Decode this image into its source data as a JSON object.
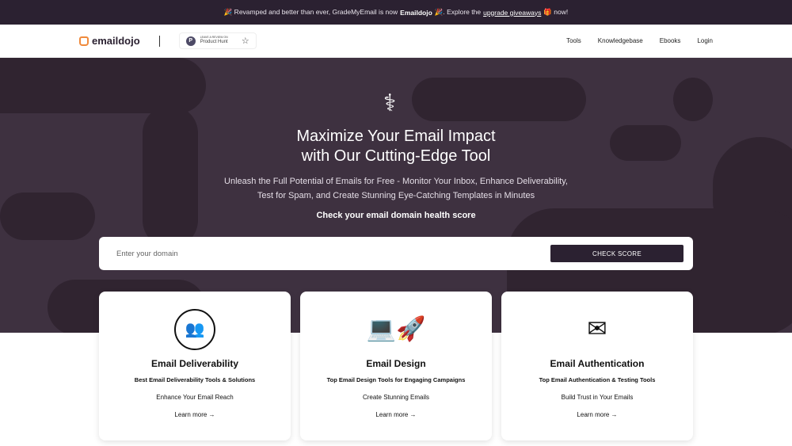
{
  "announcement": {
    "pre": "🎉 Revamped and better than ever, GradeMyEmail is now",
    "brand": "Emaildojo",
    "mid": "🎉. Explore the",
    "link": "upgrade giveaways",
    "post": "🎁 now!"
  },
  "nav": {
    "logo": "emaildojo",
    "ph_small": "LEAVE A REVIEW ON",
    "ph_label": "Product Hunt",
    "links": [
      "Tools",
      "Knowledgebase",
      "Ebooks",
      "Login"
    ]
  },
  "hero": {
    "title_line1": "Maximize Your Email Impact",
    "title_line2": "with Our Cutting-Edge Tool",
    "sub_line1": "Unleash the Full Potential of Emails for Free - Monitor Your Inbox, Enhance Deliverability,",
    "sub_line2": "Test for Spam, and Create Stunning Eye-Catching Templates in Minutes",
    "cta": "Check your email domain health score",
    "placeholder": "Enter your domain",
    "button": "CHECK SCORE"
  },
  "cards": [
    {
      "title": "Email Deliverability",
      "subtitle": "Best Email Deliverability Tools & Solutions",
      "desc": "Enhance Your Email Reach",
      "link": "Learn more →"
    },
    {
      "title": "Email Design",
      "subtitle": "Top Email Design Tools for Engaging Campaigns",
      "desc": "Create Stunning Emails",
      "link": "Learn more →"
    },
    {
      "title": "Email Authentication",
      "subtitle": "Top Email Authentication & Testing Tools",
      "desc": "Build Trust in Your Emails",
      "link": "Learn more →"
    }
  ],
  "colors": {
    "dark": "#2b2131",
    "hero": "#3e3140",
    "accent": "#f08a3c"
  }
}
